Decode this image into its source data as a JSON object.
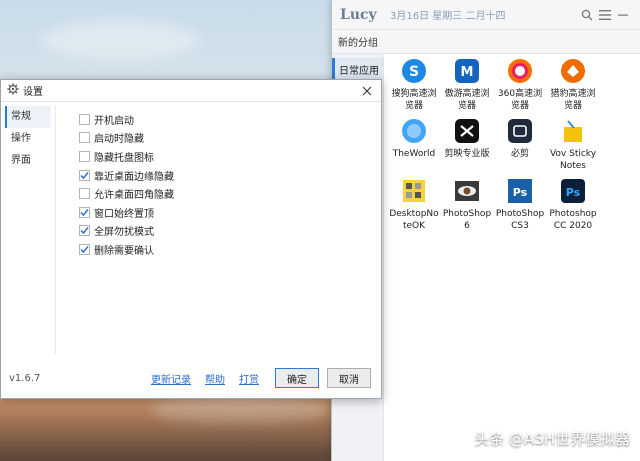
{
  "launcher": {
    "logo": "Lucy",
    "date": "3月16日 星期三 二月十四",
    "group_tab": "新的分组",
    "categories": [
      {
        "label": "日常应用"
      }
    ],
    "apps": [
      {
        "name": "搜狗高速浏览器",
        "icon": "sogou-browser-icon",
        "color": "#1e88e5"
      },
      {
        "name": "傲游高速浏览器",
        "icon": "maxthon-browser-icon",
        "color": "#1565c0"
      },
      {
        "name": "360高速浏览器",
        "icon": "360-browser-icon",
        "color": "#ff6d00"
      },
      {
        "name": "猎豹高速浏览器",
        "icon": "cheetah-browser-icon",
        "color": "#ef6c00"
      },
      {
        "name": "TheWorld",
        "icon": "theworld-browser-icon",
        "color": "#42a5f5"
      },
      {
        "name": "剪映专业版",
        "icon": "capcut-icon",
        "color": "#111111"
      },
      {
        "name": "必剪",
        "icon": "bijian-icon",
        "color": "#1f2a3a"
      },
      {
        "name": "Vov Sticky Notes",
        "icon": "sticky-notes-icon",
        "color": "#f4c20d"
      },
      {
        "name": "DesktopNoteOK",
        "icon": "desktopnoteok-icon",
        "color": "#f5d33a"
      },
      {
        "name": "PhotoShop 6",
        "icon": "photoshop-6-eye-icon",
        "color": "#3a3a3a"
      },
      {
        "name": "PhotoShop CS3",
        "icon": "photoshop-cs3-icon",
        "color": "#1a5fa8"
      },
      {
        "name": "Photoshop CC 2020",
        "icon": "photoshop-cc-icon",
        "color": "#0b1f3a"
      }
    ]
  },
  "settings": {
    "title": "设置",
    "nav": [
      {
        "label": "常规",
        "active": true
      },
      {
        "label": "操作",
        "active": false
      },
      {
        "label": "界面",
        "active": false
      }
    ],
    "options": [
      {
        "label": "开机启动",
        "checked": false
      },
      {
        "label": "启动时隐藏",
        "checked": false
      },
      {
        "label": "隐藏托盘图标",
        "checked": false
      },
      {
        "label": "靠近桌面边缘隐藏",
        "checked": true
      },
      {
        "label": "允许桌面四角隐藏",
        "checked": false
      },
      {
        "label": "窗口始终置顶",
        "checked": true
      },
      {
        "label": "全屏勿扰模式",
        "checked": true
      },
      {
        "label": "删除需要确认",
        "checked": true
      }
    ],
    "version": "v1.6.7",
    "links": {
      "changelog": "更新记录",
      "help": "帮助",
      "donate": "打赏"
    },
    "ok_label": "确定",
    "cancel_label": "取消"
  },
  "watermark": "头条 @ASH世界模拟器"
}
